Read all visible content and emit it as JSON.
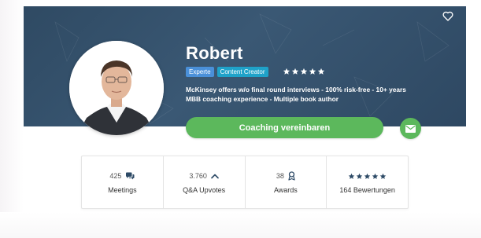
{
  "profile": {
    "name": "Robert",
    "tags": [
      "Experte",
      "Content Creator"
    ],
    "rating_stars": 5,
    "tagline_line1": "McKinsey offers w/o final round interviews - 100% risk-free - 10+ years",
    "tagline_line2": "MBB coaching experience - Multiple book author"
  },
  "actions": {
    "coaching_label": "Coaching vereinbaren",
    "favorite_icon": "heart-icon",
    "message_icon": "envelope-icon"
  },
  "stats": {
    "meetings": {
      "value": "425",
      "label": "Meetings",
      "icon": "chat-icon"
    },
    "upvotes": {
      "value": "3.760",
      "label": "Q&A Upvotes",
      "icon": "chevron-up-icon"
    },
    "awards": {
      "value": "38",
      "label": "Awards",
      "icon": "award-icon"
    },
    "reviews": {
      "stars": 5,
      "label": "164 Bewertungen"
    }
  },
  "colors": {
    "hero_bg": "#34506b",
    "primary_green": "#5cb85c",
    "tag_expert": "#4a90d9",
    "tag_content_creator": "#1fa2c9",
    "stat_icon": "#2d4a66"
  }
}
